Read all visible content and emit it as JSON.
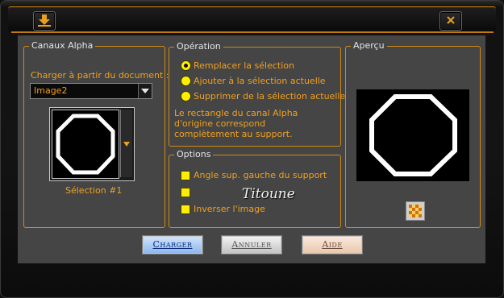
{
  "groups": {
    "alpha_channels": {
      "legend": "Canaux Alpha",
      "load_from_label": "Charger à partir du document :",
      "document_select": {
        "value": "Image2"
      },
      "selection_label": "Sélection #1"
    },
    "operation": {
      "legend": "Opération",
      "options": [
        {
          "label": "Remplacer la sélection",
          "checked": true
        },
        {
          "label": "Ajouter à la sélection actuelle",
          "checked": false
        },
        {
          "label": "Supprimer de la sélection actuelle",
          "checked": false
        }
      ],
      "info_line1": "Le rectangle du canal Alpha",
      "info_line2": "d'origine correspond",
      "info_line3": "complètement au support."
    },
    "options": {
      "legend": "Options",
      "checkboxes": [
        {
          "label": "Angle sup. gauche du support",
          "checked": true
        },
        {
          "label": "",
          "checked": true
        },
        {
          "label": "Inverser l'image",
          "checked": true
        }
      ]
    },
    "preview": {
      "legend": "Aperçu"
    }
  },
  "watermark": "Titoune",
  "buttons": {
    "load": "Charger",
    "cancel": "Annuler",
    "help": "Aide"
  },
  "colors": {
    "accent": "#f0a020",
    "panel": "#454545",
    "yellow_control": "#ffee00",
    "load_button": "#9ec4f2",
    "cancel_button": "#d0d0d0",
    "help_button": "#f2d6c0"
  },
  "icons": {
    "title_left": "download-arrow-icon",
    "title_right": "close-icon",
    "dropdown": "chevron-down-icon",
    "preview_toggle": "checker-icon"
  }
}
